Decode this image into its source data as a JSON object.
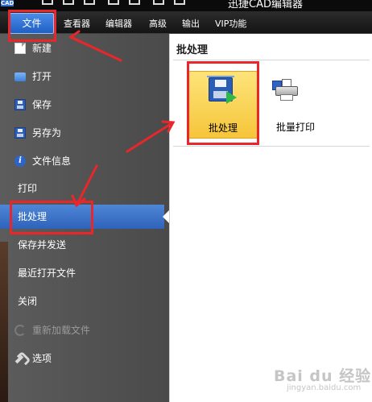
{
  "titlebar": {
    "logo_text": "CAD",
    "title": "迅捷CAD编辑器"
  },
  "menubar": {
    "tabs": [
      {
        "label": "文件",
        "active": true
      },
      {
        "label": "查看器"
      },
      {
        "label": "编辑器"
      },
      {
        "label": "高级"
      },
      {
        "label": "输出"
      },
      {
        "label": "VIP功能"
      }
    ]
  },
  "sidebar": {
    "items": [
      {
        "label": "新建",
        "icon": "new-document-icon"
      },
      {
        "label": "打开",
        "icon": "open-folder-icon"
      },
      {
        "label": "保存",
        "icon": "save-floppy-icon"
      },
      {
        "label": "另存为",
        "icon": "save-as-icon"
      },
      {
        "label": "文件信息",
        "icon": "file-info-icon"
      },
      {
        "label": "打印"
      },
      {
        "label": "批处理",
        "selected": true
      },
      {
        "label": "保存并发送"
      },
      {
        "label": "最近打开文件"
      },
      {
        "label": "关闭"
      },
      {
        "label": "重新加载文件",
        "icon": "reload-icon",
        "disabled": true
      },
      {
        "label": "选项",
        "icon": "wrench-icon"
      }
    ]
  },
  "main": {
    "title": "批处理",
    "tiles": [
      {
        "label": "批处理",
        "icon": "batch-process-icon",
        "highlighted": true
      },
      {
        "label": "批量打印",
        "icon": "batch-print-icon"
      }
    ]
  },
  "watermark": {
    "text": "Bai du 经验",
    "sub": "jingyan.baidu.com"
  },
  "colors": {
    "accent_blue": "#2f63bb",
    "annotation_red": "#e8272b",
    "sidebar_bg": "#4a4a4a",
    "tile_yellow": "#f6c53a"
  }
}
